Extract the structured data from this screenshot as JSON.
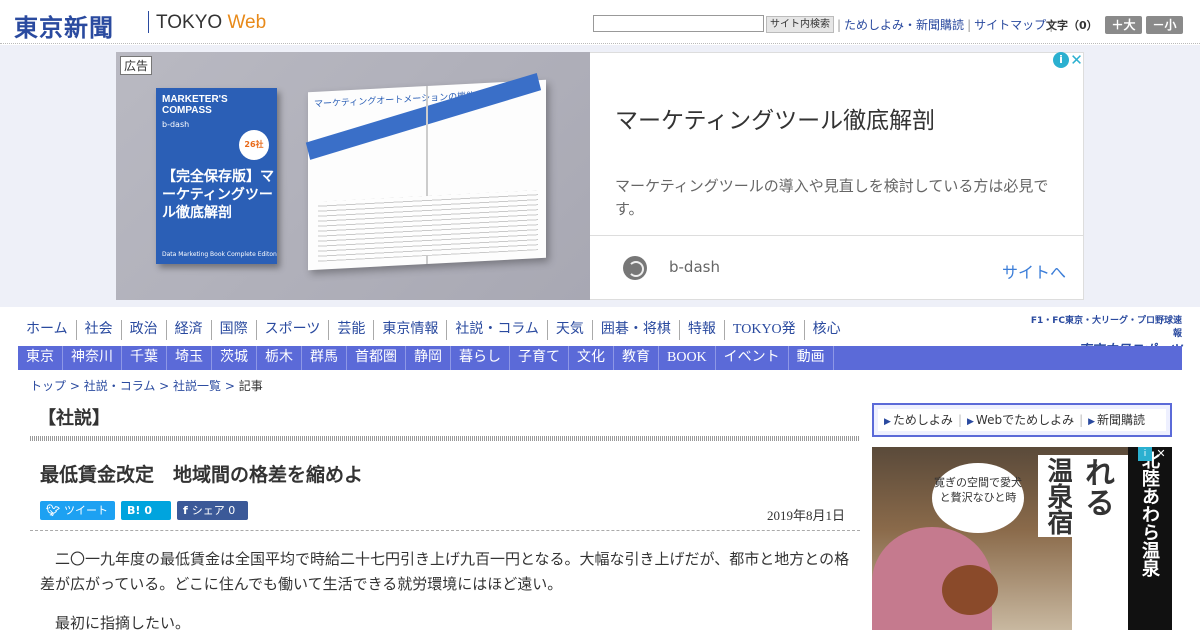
{
  "header": {
    "logo_jp": "東京新聞",
    "logo_en_prefix": "TOKYO ",
    "logo_en_suffix": "Web",
    "search_placeholder": "",
    "search_button": "サイト内検索",
    "links": [
      "ためしよみ・新聞購読",
      "サイトマップ"
    ],
    "fontsize_label": "文字（0）",
    "font_larger": "＋大",
    "font_smaller": "－小"
  },
  "ad": {
    "tag": "広告",
    "title": "マーケティングツール徹底解剖",
    "description": "マーケティングツールの導入や見直しを検討している方は必見です。",
    "brand": "b-dash",
    "site_link": "サイトへ",
    "book_title": "MARKETER'S COMPASS",
    "book_brand": "b-dash",
    "book_main": "【完全保存版】マーケティングツール徹底解剖",
    "book_badge": "26社",
    "book_sub": "Data Marketing Book Complete Editon",
    "spread_title": "マーケティングオートメーションの機能"
  },
  "nav_primary": [
    "ホーム",
    "社会",
    "政治",
    "経済",
    "国際",
    "スポーツ",
    "芸能",
    "東京情報",
    "社説・コラム",
    "天気",
    "囲碁・将棋",
    "特報",
    "TOKYO発",
    "核心"
  ],
  "f1_banner": {
    "top": "F1・FC東京・大リーグ・プロ野球速報",
    "main": "東京中日スポーツ"
  },
  "nav_secondary": [
    "東京",
    "神奈川",
    "千葉",
    "埼玉",
    "茨城",
    "栃木",
    "群馬",
    "首都圏",
    "静岡",
    "暮らし",
    "子育て",
    "文化",
    "教育",
    "BOOK",
    "イベント",
    "動画"
  ],
  "breadcrumb": {
    "items": [
      "トップ",
      "社説・コラム",
      "社説一覧"
    ],
    "current": "記事",
    "sep": " > "
  },
  "article": {
    "section": "【社説】",
    "headline": "最低賃金改定　地域間の格差を縮めよ",
    "share_tweet": "ツイート",
    "share_hatena": "0",
    "share_facebook": "シェア 0",
    "date": "2019年8月1日",
    "paragraphs": [
      "二〇一九年度の最低賃金は全国平均で時給二十七円引き上げ九百一円となる。大幅な引き上げだが、都市と地方との格差が広がっている。どこに住んでも働いて生活できる就労環境にはほど遠い。",
      "最初に指摘したい。"
    ]
  },
  "sidebar": {
    "links": [
      "ためしよみ",
      "Webでためしよみ",
      "新聞購読"
    ],
    "ad_bubble": "寛ぎの空間で愛犬と贅沢なひと時",
    "ad_v1": "温泉宿",
    "ad_v2": "愛犬と泊まれる",
    "ad_v3": "北陸あわら温泉"
  },
  "colors": {
    "brand": "#2a4a9f",
    "nav_bar": "#5b6ad8",
    "web_accent": "#e88a1a"
  }
}
